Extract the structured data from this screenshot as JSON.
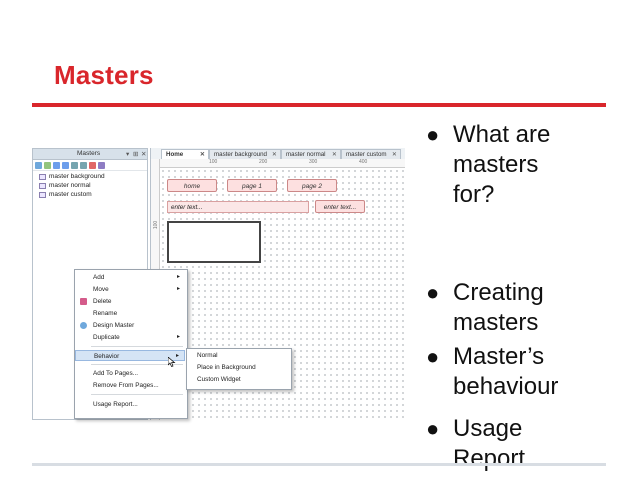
{
  "slide": {
    "title": "Masters",
    "bullets": [
      "What are\nmasters\nfor?",
      "Creating\nmasters",
      "Master’s\nbehaviour",
      "Usage\nReport"
    ]
  },
  "masters_panel": {
    "title": "Masters",
    "controls": [
      "▾",
      "⊞",
      "✕"
    ],
    "items": [
      "master background",
      "master normal",
      "master custom"
    ]
  },
  "tabs": [
    {
      "label": "Home",
      "close": "✕"
    },
    {
      "label": "master background",
      "close": "✕"
    },
    {
      "label": "master normal",
      "close": "✕"
    },
    {
      "label": "master custom",
      "close": "✕"
    }
  ],
  "rulers": {
    "h": [
      "100",
      "200",
      "300",
      "400"
    ],
    "v": [
      "100"
    ]
  },
  "canvas": {
    "buttons": [
      "home",
      "page 1",
      "page 2"
    ],
    "field_text": "enter text...",
    "small_field_text": "enter text..."
  },
  "context_menu": {
    "items": [
      {
        "label": "Add",
        "arrow": "▸"
      },
      {
        "label": "Move",
        "arrow": "▸"
      },
      {
        "label": "Delete"
      },
      {
        "label": "Rename"
      },
      {
        "label": "Design Master"
      },
      {
        "label": "Duplicate",
        "arrow": "▸"
      },
      {
        "label": "Behavior",
        "arrow": "▸"
      },
      {
        "label": "Add To Pages..."
      },
      {
        "label": "Remove From Pages..."
      },
      {
        "label": "Usage Report..."
      }
    ]
  },
  "behavior_submenu": [
    "Normal",
    "Place in Background",
    "Custom Widget"
  ],
  "colors": {
    "accent": "#d9262b",
    "menu_highlight": "#d5e4f5",
    "widget_fill": "#fde0e0"
  }
}
